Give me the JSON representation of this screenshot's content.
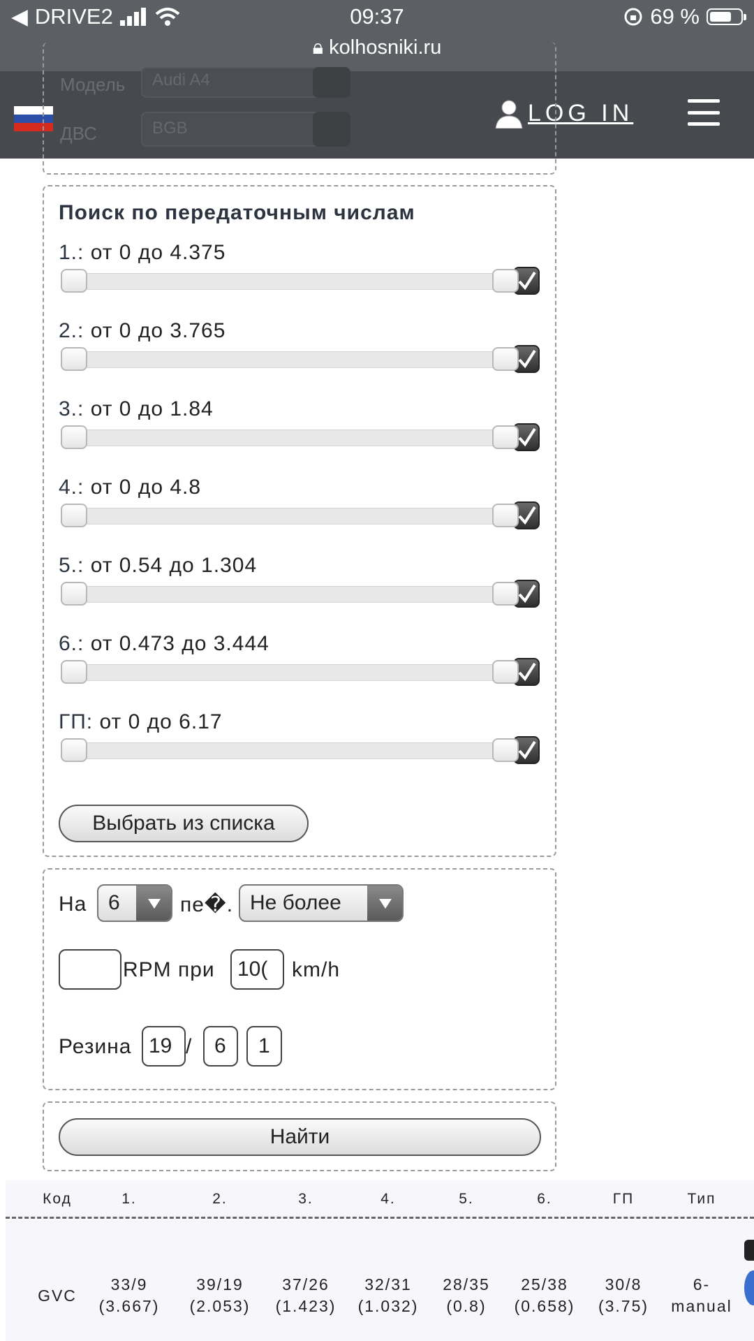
{
  "status_bar": {
    "carrier": "DRIVE2",
    "time": "09:37",
    "battery": "69 %",
    "battery_level": 0.69,
    "url": "kolhosniki.ru"
  },
  "header": {
    "login_label": "LOG IN",
    "background_fields": {
      "model_label": "Модель",
      "model_value": "Audi A4",
      "engine_label": "ДВС",
      "engine_value": "BGB"
    }
  },
  "ratio_search": {
    "title": "Поиск по передаточным числам",
    "ranges": [
      {
        "key": "1.:",
        "text": "от 0 до 4.375"
      },
      {
        "key": "2.:",
        "text": "от 0 до 3.765"
      },
      {
        "key": "3.:",
        "text": "от 0 до 1.84"
      },
      {
        "key": "4.:",
        "text": "от 0 до 4.8"
      },
      {
        "key": "5.:",
        "text": "от 0.54 до 1.304"
      },
      {
        "key": "6.:",
        "text": "от 0.473 до 3.444"
      },
      {
        "key": "ГП:",
        "text": "от 0 до 6.17"
      }
    ],
    "choose_button": "Выбрать из списка"
  },
  "rpm_calc": {
    "on_label": "На",
    "gear_value": "6",
    "gear_suffix": "пе�.",
    "condition_value": "Не более",
    "rpm_value": "",
    "rpm_label": "RPM при",
    "speed_value": "10(",
    "speed_unit": "km/h",
    "tire_label": "Резина",
    "tire_width": "19",
    "slash": "/",
    "tire_profile": "6",
    "tire_radius": "1"
  },
  "search_button": "Найти",
  "results_table": {
    "headers": [
      "Код",
      "1.",
      "2.",
      "3.",
      "4.",
      "5.",
      "6.",
      "ГП",
      "Тип"
    ],
    "rows": [
      {
        "code": "GVC",
        "g1": [
          "33/9",
          "(3.667)"
        ],
        "g2": [
          "39/19",
          "(2.053)"
        ],
        "g3": [
          "37/26",
          "(1.423)"
        ],
        "g4": [
          "32/31",
          "(1.032)"
        ],
        "g5": [
          "28/35",
          "(0.8)"
        ],
        "g6": [
          "25/38",
          "(0.658)"
        ],
        "gp": [
          "30/8",
          "(3.75)"
        ],
        "type": [
          "6-",
          "manual"
        ]
      }
    ]
  },
  "colors": {
    "status_bar": "#5c5f63",
    "header": "#46494e",
    "page": "#ffffff"
  }
}
